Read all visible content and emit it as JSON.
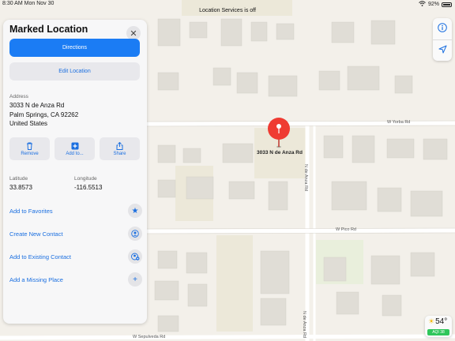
{
  "status_bar": {
    "time": "8:30 AM  Mon Nov 30",
    "center_text": "Location Services is off",
    "battery": "92%"
  },
  "panel": {
    "title": "Marked Location",
    "directions_label": "Directions",
    "edit_label": "Edit Location",
    "address_label": "Address",
    "address_lines": [
      "3033 N de Anza Rd",
      "Palm Springs, CA  92262",
      "United States"
    ],
    "actions": [
      {
        "label": "Remove",
        "icon": "trash-icon"
      },
      {
        "label": "Add to...",
        "icon": "plus-square-icon"
      },
      {
        "label": "Share",
        "icon": "share-icon"
      }
    ],
    "latitude_label": "Latitude",
    "latitude_value": "33.8573",
    "longitude_label": "Longitude",
    "longitude_value": "-116.5513",
    "list": [
      {
        "label": "Add to Favorites",
        "icon": "star-icon"
      },
      {
        "label": "Create New Contact",
        "icon": "contact-icon"
      },
      {
        "label": "Add to Existing Contact",
        "icon": "add-contact-icon"
      },
      {
        "label": "Add a Missing Place",
        "icon": "plus-icon"
      }
    ]
  },
  "map": {
    "pin_label": "3033 N de Anza Rd",
    "streets": {
      "yorba": "W Yorba Rd",
      "anza": "N de Anza Rd",
      "pico": "W Pico Rd",
      "sepulveda": "W Sepulveda Rd"
    },
    "pin_color": "#ef3b32"
  },
  "weather": {
    "temperature": "54°",
    "aqi": "AQI 38"
  },
  "colors": {
    "accent": "#1b7cf4",
    "link": "#1b6fe0"
  }
}
